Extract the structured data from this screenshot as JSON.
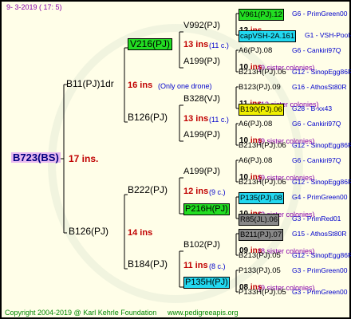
{
  "header": {
    "date": "9-  3-2019  ( 17:  5)"
  },
  "footer": {
    "copyright": "Copyright 2004-2019 @ Karl Kehrle Foundation",
    "site": "www.pedigreeapis.org"
  },
  "colors": {
    "green": "#22dd22",
    "cyan": "#22d8f0",
    "yellow": "#f0f000",
    "gray": "#888888",
    "root": "#e8b8f0"
  },
  "root": {
    "label": "B723(BS)",
    "ins": "17 ins."
  },
  "gen1": {
    "top": {
      "label": "B11(PJ)1dr",
      "ins": "16 ins",
      "note": "(Only one drone)"
    },
    "bottom": {
      "label": "B126(PJ)",
      "ins": "14 ins"
    }
  },
  "gen2": [
    {
      "label": "V216(PJ)",
      "ins": "13 ins",
      "note": "(11 c.)"
    },
    {
      "label": "B126(PJ)",
      "ins": "13 ins",
      "note": "(11 c.)"
    },
    {
      "label": "B222(PJ)",
      "ins": "12 ins",
      "note": "(9 c.)"
    },
    {
      "label": "B184(PJ)",
      "ins": "11 ins",
      "note": "(8 c.)"
    }
  ],
  "gen3": [
    {
      "label": "V992(PJ)",
      "ins": "12 ins",
      "note": ""
    },
    {
      "label": "A199(PJ)",
      "ins": "10 ins",
      "note": "(9 sister colonies)"
    },
    {
      "label": "B328(VJ)",
      "ins": "11 ins",
      "note": "(12 sister colonies)"
    },
    {
      "label": "A199(PJ)",
      "ins": "10 ins",
      "note": "(9 sister colonies)"
    },
    {
      "label": "A199(PJ)",
      "ins": "10 ins",
      "note": "(9 sister colonies)"
    },
    {
      "label": "P216H(PJ)",
      "ins": "10 ins",
      "note": "(3 sister colonies)"
    },
    {
      "label": "B102(PJ)",
      "ins": "09 ins",
      "note": "(8 sister colonies)"
    },
    {
      "label": "P135H(PJ)",
      "ins": "08 ins",
      "note": "(9 sister colonies)"
    }
  ],
  "gen4": [
    {
      "label": "V961(PJ).12",
      "info": "G6 - PrimGreen00"
    },
    {
      "label": "capVSH-2A.161",
      "info": "G1 - VSH-Pool-AR"
    },
    {
      "label": "A6(PJ).08",
      "info": "G6 - Cankiri97Q"
    },
    {
      "label": "B213H(PJ).06",
      "info": "G12 - SinopEgg86R"
    },
    {
      "label": "B123(PJ).09",
      "info": "G16 - AthosSt80R"
    },
    {
      "label": "B190(PJ).06",
      "info": "G28 - B-xx43"
    },
    {
      "label": "A6(PJ).08",
      "info": "G6 - Cankiri97Q"
    },
    {
      "label": "B213H(PJ).06",
      "info": "G12 - SinopEgg86R"
    },
    {
      "label": "A6(PJ).08",
      "info": "G6 - Cankiri97Q"
    },
    {
      "label": "B213H(PJ).06",
      "info": "G12 - SinopEgg86R"
    },
    {
      "label": "P135(PJ).08",
      "info": "G4 - PrimGreen00"
    },
    {
      "label": "R85(JL).06",
      "info": "G3 - PrimRed01"
    },
    {
      "label": "B211(PJ).07",
      "info": "G15 - AthosSt80R"
    },
    {
      "label": "B213(PJ).05",
      "info": "G12 - SinopEgg86R"
    },
    {
      "label": "P133(PJ).05",
      "info": "G3 - PrimGreen00"
    },
    {
      "label": "P133H(PJ).05",
      "info": "G3 - PrimGreen00"
    }
  ]
}
